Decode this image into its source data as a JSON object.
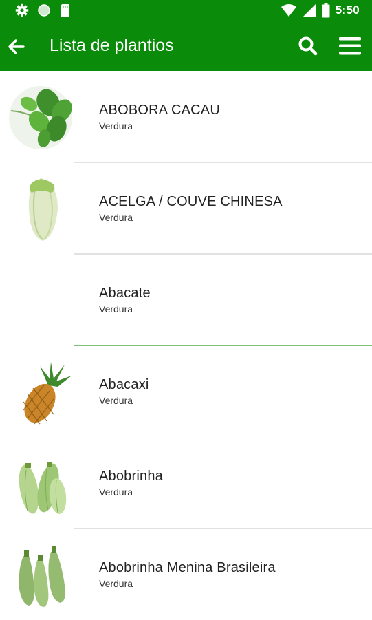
{
  "status": {
    "time": "5:50"
  },
  "appbar": {
    "title": "Lista de plantios"
  },
  "icons": {
    "gear": "gear-icon",
    "circle": "circle-status-icon",
    "sdcard": "sd-card-icon",
    "wifi": "wifi-icon",
    "signal": "signal-icon",
    "battery": "battery-icon",
    "back": "back-arrow-icon",
    "search": "search-icon",
    "menu": "menu-icon"
  },
  "colors": {
    "primary": "#0a8c0a",
    "divider": "#e2e2e2",
    "active_divider": "#7cc07c"
  },
  "items": [
    {
      "name": "ABOBORA CACAU",
      "category": "Verdura"
    },
    {
      "name": "ACELGA / COUVE CHINESA",
      "category": "Verdura"
    },
    {
      "name": "Abacate",
      "category": "Verdura"
    },
    {
      "name": "Abacaxi",
      "category": "Verdura"
    },
    {
      "name": "Abobrinha",
      "category": "Verdura"
    },
    {
      "name": "Abobrinha Menina Brasileira",
      "category": "Verdura"
    }
  ]
}
